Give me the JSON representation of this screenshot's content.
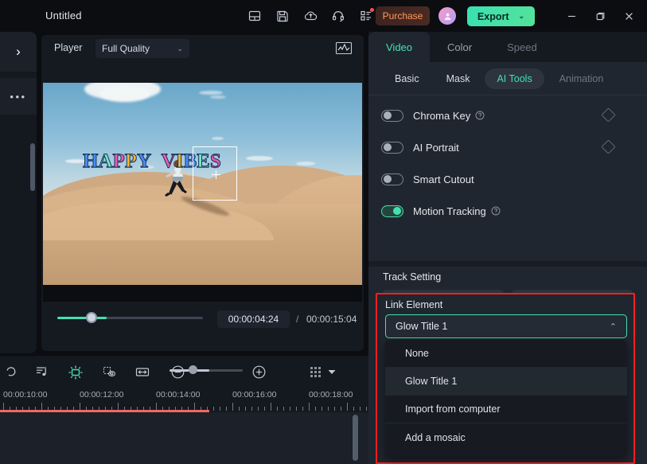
{
  "titlebar": {
    "doc_title": "Untitled",
    "icons": [
      "layout-panel-icon",
      "save-icon",
      "cloud-upload-icon",
      "headset-support-icon",
      "apps-grid-icon"
    ],
    "purchase_label": "Purchase",
    "export_label": "Export",
    "export_caret": "⌄",
    "window": {
      "minimize": "─",
      "maximize": "❐",
      "close": "✕"
    }
  },
  "left_rail": {
    "expand_chevron": "›",
    "more_label": "•••"
  },
  "player": {
    "label": "Player",
    "quality": "Full Quality",
    "quality_caret": "⌄",
    "current_time": "00:00:04:24",
    "separator": "/",
    "total_time": "00:00:15:04",
    "overlay_title": "HAPPY VIBES",
    "title_letters": [
      {
        "ch": "H",
        "color": "#4c8ef5"
      },
      {
        "ch": "A",
        "color": "#74e8c0"
      },
      {
        "ch": "P",
        "color": "#f05ab0"
      },
      {
        "ch": "P",
        "color": "#f7b733"
      },
      {
        "ch": "Y",
        "color": "#4c8ef5"
      },
      {
        "ch": " ",
        "color": "#ffffff"
      },
      {
        "ch": " ",
        "color": "#ffffff"
      },
      {
        "ch": "V",
        "color": "#f05ab0"
      },
      {
        "ch": "I",
        "color": "#f7b733"
      },
      {
        "ch": "B",
        "color": "#4c8ef5"
      },
      {
        "ch": "E",
        "color": "#74e8c0"
      },
      {
        "ch": "S",
        "color": "#f05ab0"
      }
    ],
    "controls": [
      "prev-frame-button",
      "next-frame-button",
      "play-button",
      "stop-button",
      "mark-in-button",
      "mark-out-button",
      "add-marker-button",
      "marker-dropdown-button",
      "screen-cast-button",
      "snapshot-button",
      "volume-button",
      "fullscreen-button"
    ],
    "brace_in": "{",
    "brace_out": "}"
  },
  "right_panel": {
    "tabs": [
      {
        "label": "Video",
        "active": true
      },
      {
        "label": "Color",
        "active": false
      },
      {
        "label": "Speed",
        "active": false,
        "muted": true
      }
    ],
    "subtabs": [
      {
        "label": "Basic",
        "active": false
      },
      {
        "label": "Mask",
        "active": false
      },
      {
        "label": "AI Tools",
        "active": true
      },
      {
        "label": "Animation",
        "active": false,
        "faded": true
      }
    ],
    "tools": [
      {
        "label": "Chroma Key",
        "on": false,
        "help": true,
        "keyframe": true
      },
      {
        "label": "AI Portrait",
        "on": false,
        "help": false,
        "keyframe": true
      },
      {
        "label": "Smart Cutout",
        "on": false,
        "help": false,
        "keyframe": false
      },
      {
        "label": "Motion Tracking",
        "on": true,
        "help": true,
        "keyframe": false
      }
    ],
    "track_setting_label": "Track Setting",
    "track_buttons": [
      "blend-mode-icon",
      "visibility-eye-icon"
    ],
    "link_element": {
      "label": "Link Element",
      "selected": "Glow Title 1",
      "chevron": "⌃",
      "options": [
        {
          "label": "None",
          "highlighted": false
        },
        {
          "label": "Glow Title 1",
          "highlighted": true
        },
        {
          "label": "Import from computer",
          "highlighted": false
        },
        {
          "label": "Add a mosaic",
          "highlighted": false
        }
      ]
    },
    "highlight_color": "#ff2020"
  },
  "timeline": {
    "toolbar_icons": [
      "undo-icon",
      "audio-detach-icon",
      "motion-tracking-icon",
      "mask-eye-icon",
      "fit-width-icon",
      "zoom-out-icon",
      "zoom-in-icon",
      "grid-view-icon",
      "grid-dropdown-icon"
    ],
    "zoom_minus": "⊖",
    "zoom_plus": "⊕",
    "ruler_labels": [
      "00:00:10:00",
      "00:00:12:00",
      "00:00:14:00",
      "00:00:16:00",
      "00:00:18:00"
    ],
    "ruler_label_x": [
      4,
      100,
      196,
      292,
      388
    ]
  },
  "colors": {
    "accent_teal": "#45e0b0",
    "highlight_red": "#ff2020",
    "panel_bg": "#20262f",
    "window_bg": "#0b0d11",
    "timeline_red": "#f4675f"
  }
}
